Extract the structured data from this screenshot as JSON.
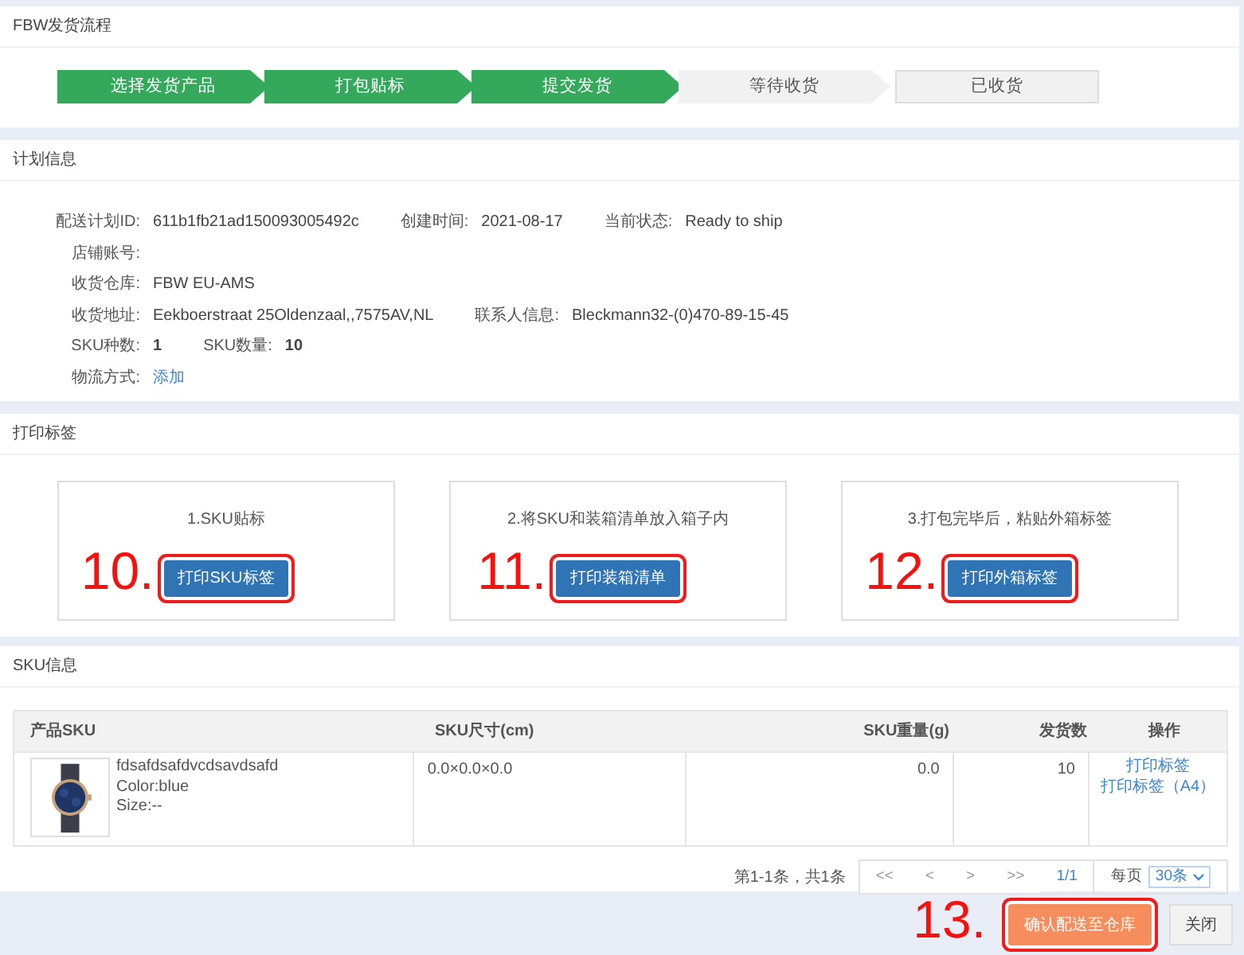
{
  "flow": {
    "title": "FBW发货流程",
    "steps": [
      {
        "label": "选择发货产品",
        "done": true
      },
      {
        "label": "打包贴标",
        "done": true
      },
      {
        "label": "提交发货",
        "done": true
      },
      {
        "label": "等待收货",
        "done": false
      },
      {
        "label": "已收货",
        "done": false
      }
    ]
  },
  "plan": {
    "title": "计划信息",
    "rows": [
      [
        {
          "label": "配送计划ID:",
          "value": "611b1fb21ad150093005492c",
          "kind": "text"
        },
        {
          "label": "创建时间:",
          "value": "2021-08-17",
          "kind": "text"
        },
        {
          "label": "当前状态:",
          "value": "Ready to ship",
          "kind": "text"
        }
      ],
      [
        {
          "label": "店铺账号:"
        }
      ],
      [
        {
          "label": "收货仓库:",
          "value": "FBW EU-AMS",
          "kind": "text"
        }
      ],
      [
        {
          "label": "收货地址:",
          "value": "Eekboerstraat 25Oldenzaal,,7575AV,NL",
          "kind": "text"
        },
        {
          "label": "联系人信息:",
          "value": "Bleckmann32-(0)470-89-15-45",
          "kind": "text"
        }
      ],
      [
        {
          "label": "SKU种数:",
          "value": "1",
          "kind": "bold"
        },
        {
          "label": "SKU数量:",
          "value": "10",
          "kind": "bold"
        }
      ],
      [
        {
          "label": "物流方式:",
          "value": "添加",
          "kind": "link"
        }
      ]
    ]
  },
  "print": {
    "title": "打印标签",
    "cards": [
      {
        "caption": "1.SKU贴标",
        "button": "打印SKU标签",
        "annotation": "10.",
        "highlighted": true
      },
      {
        "caption": "2.将SKU和装箱清单放入箱子内",
        "button": "打印装箱清单",
        "annotation": "11.",
        "highlighted": true
      },
      {
        "caption": "3.打包完毕后，粘贴外箱标签",
        "button": "打印外箱标签",
        "annotation": "12.",
        "highlighted": true
      }
    ]
  },
  "sku": {
    "title": "SKU信息",
    "columns": [
      "产品SKU",
      "SKU尺寸(cm)",
      "SKU重量(g)",
      "发货数",
      "操作"
    ],
    "rows": [
      {
        "product": {
          "kind": "picture",
          "name": "fdsafdsafdvcdsavdsafd",
          "variant": "Color:blue",
          "size": "Size:--"
        },
        "dimensions": "0.0×0.0×0.0",
        "weight": "0.0",
        "quantity": "10",
        "actions": [
          "打印标签",
          "打印标签（A4）"
        ]
      }
    ],
    "pagination": {
      "summary": "第1-1条，共1条",
      "buttons": [
        "<<",
        "<",
        ">",
        ">>"
      ],
      "page": "1/1",
      "per_page_label": "每页",
      "per_page": "30条"
    }
  },
  "footer": {
    "buttons": [
      {
        "label": "确认配送至仓库",
        "kind": "primary",
        "annotation": "13.",
        "highlighted": true
      },
      {
        "label": "关闭",
        "kind": "default",
        "highlighted": false
      }
    ]
  }
}
